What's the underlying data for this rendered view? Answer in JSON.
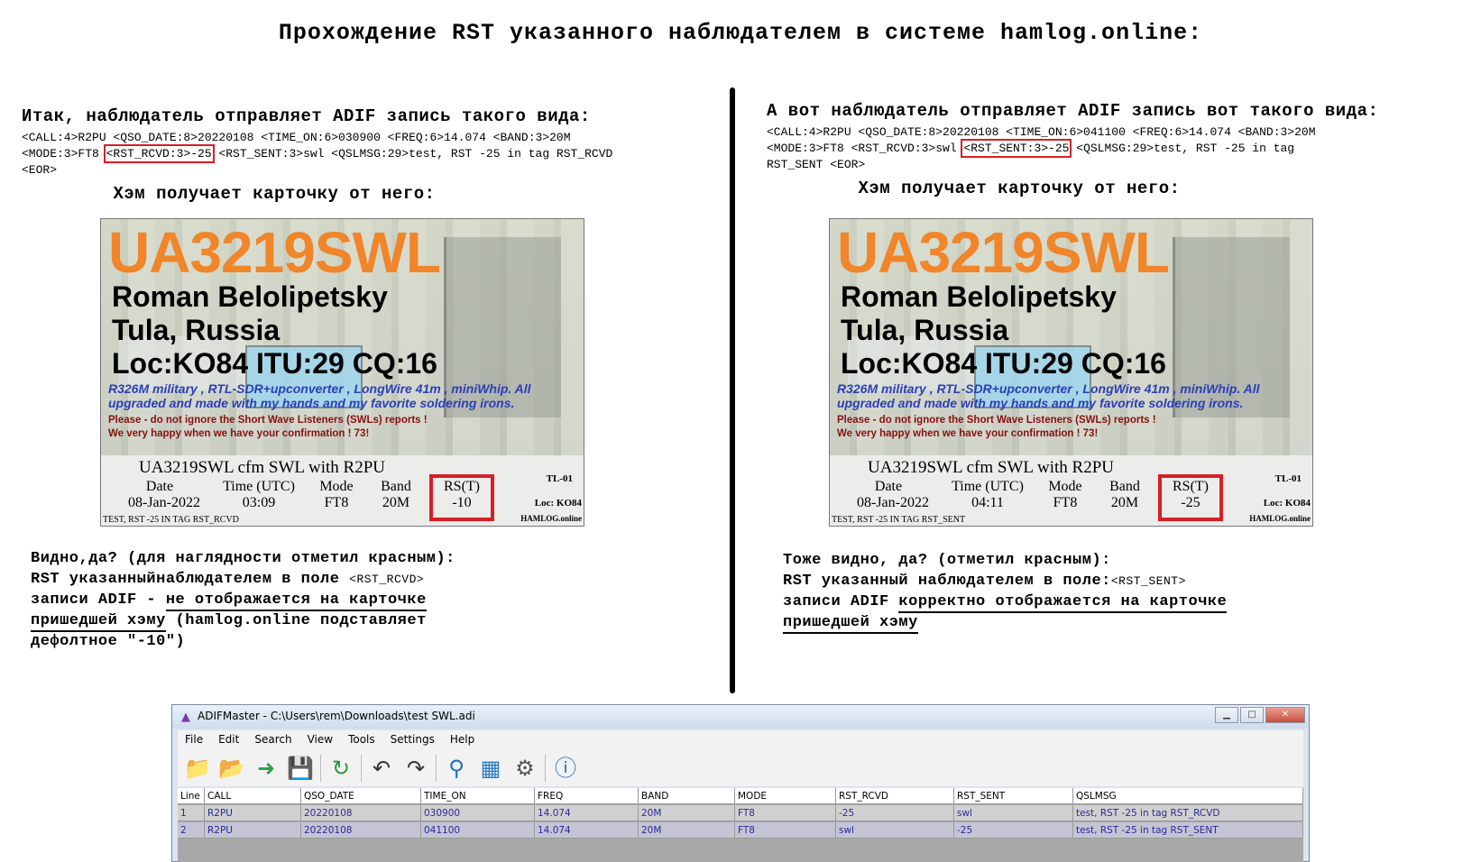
{
  "title": "Прохождение RST указанного наблюдателем в системе hamlog.online:",
  "left": {
    "intro": "Итак, наблюдатель отправляет ADIF запись такого вида:",
    "adif_l1": "<CALL:4>R2PU <QSO_DATE:8>20220108 <TIME_ON:6>030900 <FREQ:6>14.074 <BAND:3>20M",
    "adif_l2_pre": "<MODE:3>FT8 ",
    "adif_l2_box": "<RST_RCVD:3>-25",
    "adif_l2_post": " <RST_SENT:3>swl <QSLMSG:29>test, RST -25 in tag RST_RCVD",
    "adif_l3": "<EOR>",
    "ham_gets": "Хэм получает карточку от него:",
    "note_l1": "Видно,да? (для наглядности отметил красным):",
    "note_l2_pre": "RST указанныйнаблюдателем в поле ",
    "note_l2_tag": "<RST_RCVD>",
    "note_l3_pre": "записи ADIF - ",
    "note_l3_ul": "не отображается на карточке",
    "note_l4_ul": "пришедшей хэму",
    "note_l4_post": " (hamlog.online подставляет",
    "note_l5": "дефолтное \"-10\")"
  },
  "right": {
    "intro": "А вот наблюдатель отправляет ADIF запись вот такого вида:",
    "adif_l1": "<CALL:4>R2PU <QSO_DATE:8>20220108 <TIME_ON:6>041100 <FREQ:6>14.074 <BAND:3>20M",
    "adif_l2_pre": "<MODE:3>FT8 <RST_RCVD:3>swl ",
    "adif_l2_box": "<RST_SENT:3>-25",
    "adif_l2_post": " <QSLMSG:29>test, RST -25 in tag",
    "adif_l3": "RST_SENT <EOR>",
    "ham_gets": "Хэм получает карточку от него:",
    "note_l1": "Тоже видно, да? (отметил красным):",
    "note_l2_pre": "RST указанный наблюдателем в поле:",
    "note_l2_tag": "<RST_SENT>",
    "note_l3_pre": "записи ADIF ",
    "note_l3_ul": "корректно отображается на карточке",
    "note_l4_ul": "пришедшей хэму"
  },
  "card_common": {
    "callsign": "UA3219SWL",
    "name": "Roman Belolipetsky",
    "city": "Tula, Russia",
    "loc": "Loc:KO84  ITU:29  CQ:16",
    "equip_l1": "R326M military , RTL-SDR+upconverter , LongWire 41m , miniWhip. All",
    "equip_l2": "upgraded and made with my hands and my favorite soldering irons.",
    "please_l1": "Please - do not ignore the Short Wave Listeners (SWLs) reports !",
    "please_l2": "We very happy when we have your confirmation ! 73!",
    "cfm": "UA3219SWL cfm SWL with R2PU",
    "h_date": "Date",
    "h_time": "Time (UTC)",
    "h_mode": "Mode",
    "h_band": "Band",
    "h_rs": "RS(T)",
    "tl": "TL-01",
    "lock": "Loc: KO84",
    "hamlog": "HAMLOG.online"
  },
  "card_left": {
    "date": "08-Jan-2022",
    "time": "03:09",
    "mode": "FT8",
    "band": "20M",
    "rs": "-10",
    "footnote": "TEST, RST -25 IN TAG RST_RCVD"
  },
  "card_right": {
    "date": "08-Jan-2022",
    "time": "04:11",
    "mode": "FT8",
    "band": "20M",
    "rs": "-25",
    "footnote": "TEST, RST -25 IN TAG RST_SENT"
  },
  "window": {
    "title": "ADIFMaster - C:\\Users\\rem\\Downloads\\test SWL.adi",
    "menu": [
      "File",
      "Edit",
      "Search",
      "View",
      "Tools",
      "Settings",
      "Help"
    ],
    "columns": [
      "Line",
      "CALL",
      "QSO_DATE",
      "TIME_ON",
      "FREQ",
      "BAND",
      "MODE",
      "RST_RCVD",
      "RST_SENT",
      "QSLMSG"
    ],
    "rows": [
      [
        "1",
        "R2PU",
        "20220108",
        "030900",
        "14.074",
        "20M",
        "FT8",
        "-25",
        "swl",
        "test, RST -25 in tag RST_RCVD"
      ],
      [
        "2",
        "R2PU",
        "20220108",
        "041100",
        "14.074",
        "20M",
        "FT8",
        "swl",
        "-25",
        "test, RST -25 in tag RST_SENT"
      ]
    ]
  },
  "colors": {
    "highlight_red": "#d81e27",
    "callsign_orange": "#f0852a",
    "equip_blue": "#2b3fb8"
  }
}
